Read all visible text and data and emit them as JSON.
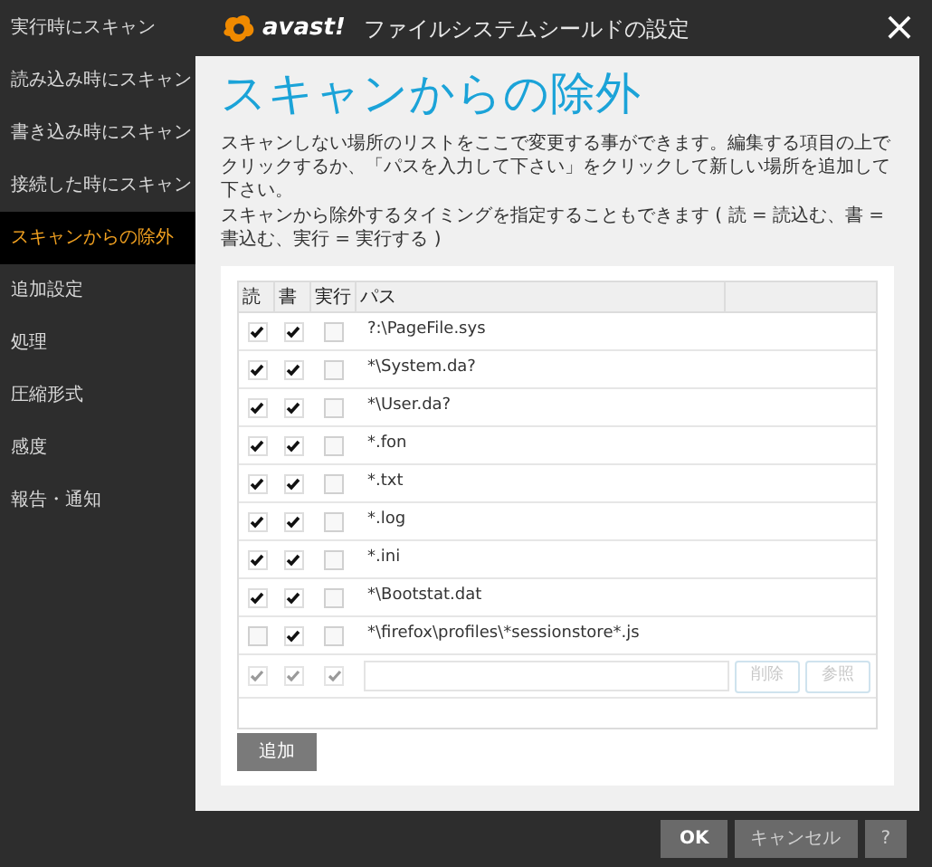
{
  "sidebar": {
    "items": [
      {
        "label": "実行時にスキャン",
        "selected": false
      },
      {
        "label": "読み込み時にスキャン",
        "selected": false
      },
      {
        "label": "書き込み時にスキャン",
        "selected": false
      },
      {
        "label": "接続した時にスキャン",
        "selected": false
      },
      {
        "label": "スキャンからの除外",
        "selected": true
      },
      {
        "label": "追加設定",
        "selected": false
      },
      {
        "label": "処理",
        "selected": false
      },
      {
        "label": "圧縮形式",
        "selected": false
      },
      {
        "label": "感度",
        "selected": false
      },
      {
        "label": "報告・通知",
        "selected": false
      }
    ]
  },
  "window": {
    "logo": "avast!",
    "title": "ファイルシステムシールドの設定",
    "close": "×"
  },
  "page": {
    "heading": "スキャンからの除外",
    "description": [
      "スキャンしない場所のリストをここで変更する事ができます。編集する項目の上でクリックするか、「パスを入力して下さい」をクリックして新しい場所を追加して下さい。",
      "スキャンから除外するタイミングを指定することもできます ( 読 = 読込む、書 = 書込む、実行 = 実行する )"
    ]
  },
  "table": {
    "columns": [
      "読",
      "書",
      "実行",
      "パス"
    ],
    "rows": [
      {
        "read": true,
        "write": true,
        "exec": false,
        "path": "?:\\PageFile.sys"
      },
      {
        "read": true,
        "write": true,
        "exec": false,
        "path": "*\\System.da?"
      },
      {
        "read": true,
        "write": true,
        "exec": false,
        "path": "*\\User.da?"
      },
      {
        "read": true,
        "write": true,
        "exec": false,
        "path": "*.fon"
      },
      {
        "read": true,
        "write": true,
        "exec": false,
        "path": "*.txt"
      },
      {
        "read": true,
        "write": true,
        "exec": false,
        "path": "*.log"
      },
      {
        "read": true,
        "write": true,
        "exec": false,
        "path": "*.ini"
      },
      {
        "read": true,
        "write": true,
        "exec": false,
        "path": "*\\Bootstat.dat"
      },
      {
        "read": false,
        "write": true,
        "exec": false,
        "path": "*\\firefox\\profiles\\*sessionstore*.js"
      }
    ],
    "new_row": {
      "read": true,
      "write": true,
      "exec": true,
      "disabled": true,
      "buttons": [
        {
          "label": "削除",
          "disabled": true
        },
        {
          "label": "参照",
          "disabled": true
        }
      ]
    }
  },
  "add_button": "追加",
  "footer": {
    "buttons": [
      {
        "label": "OK",
        "primary": true
      },
      {
        "label": "キャンセル",
        "primary": false
      },
      {
        "label": "?",
        "primary": false
      }
    ]
  }
}
